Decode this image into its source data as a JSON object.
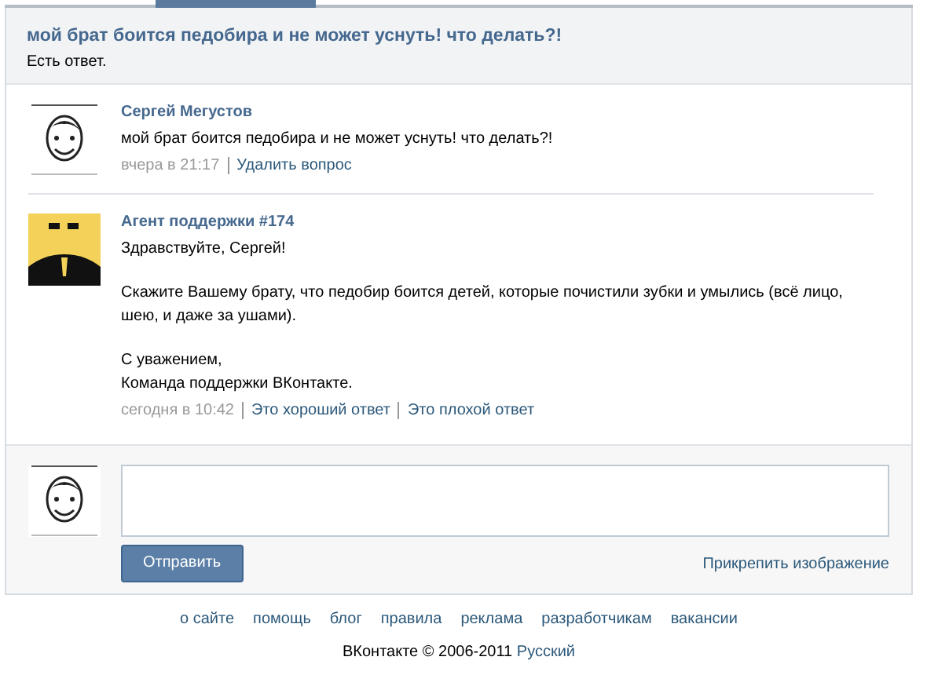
{
  "question": {
    "title": "мой брат боится педобира и не может уснуть! что делать?!",
    "status": "Есть ответ."
  },
  "posts": [
    {
      "kind": "user",
      "author": "Сергей Мегустов",
      "paragraphs": [
        "мой брат боится педобира и не может уснуть! что делать?!"
      ],
      "time": "вчера в 21:17",
      "actions": [
        "Удалить вопрос"
      ]
    },
    {
      "kind": "agent",
      "author": "Агент поддержки #174",
      "paragraphs": [
        "Здравствуйте, Сергей!",
        "Скажите Вашему брату, что педобир боится детей, которые почистили зубки и умылись (всё лицо, шею, и даже за ушами).",
        "С уважением,\nКоманда поддержки ВКонтакте."
      ],
      "time": "сегодня в 10:42",
      "actions": [
        "Это хороший ответ",
        "Это плохой ответ"
      ]
    }
  ],
  "reply": {
    "send_button": "Отправить",
    "attach_link": "Прикрепить изображение"
  },
  "footer": {
    "links": [
      "о сайте",
      "помощь",
      "блог",
      "правила",
      "реклама",
      "разработчикам",
      "вакансии"
    ],
    "copyright": "ВКонтакте © 2006-2011",
    "language": "Русский"
  }
}
